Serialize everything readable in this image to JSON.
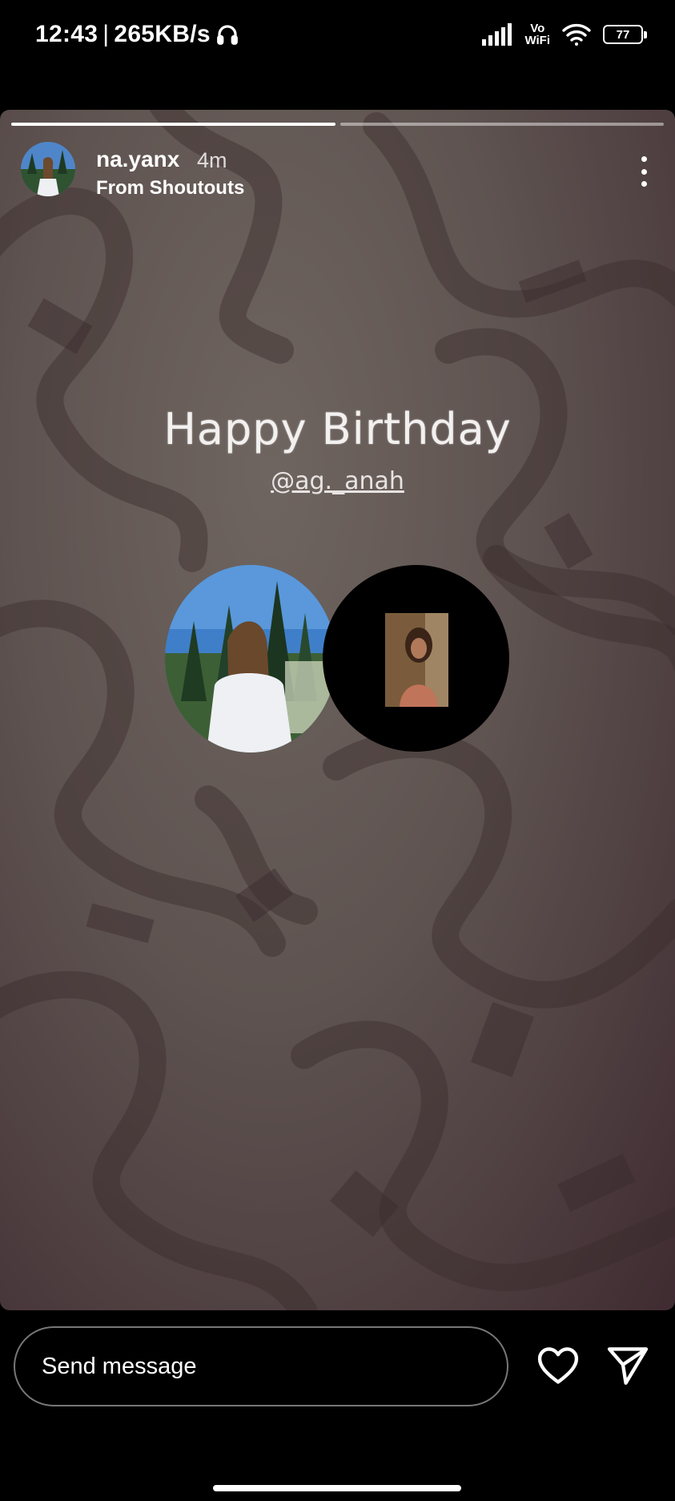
{
  "status_bar": {
    "time": "12:43",
    "separator": "|",
    "speed": "265KB/s",
    "vowifi_line1": "Vo",
    "vowifi_line2": "WiFi",
    "battery": "77"
  },
  "story": {
    "progress_segments": 2,
    "progress_current": 1,
    "username": "na.yanx",
    "time_ago": "4m",
    "source": "From Shoutouts",
    "title": "Happy Birthday",
    "mention": "@ag._anah"
  },
  "bottom": {
    "message_placeholder": "Send message"
  },
  "colors": {
    "background": "#000000",
    "story_bg_light": "#6f6560",
    "story_bg_dark": "#3f2b31"
  },
  "icons": [
    "headphones-icon",
    "signal-icon",
    "wifi-icon",
    "battery-icon",
    "more-options-icon",
    "heart-icon",
    "send-icon"
  ]
}
